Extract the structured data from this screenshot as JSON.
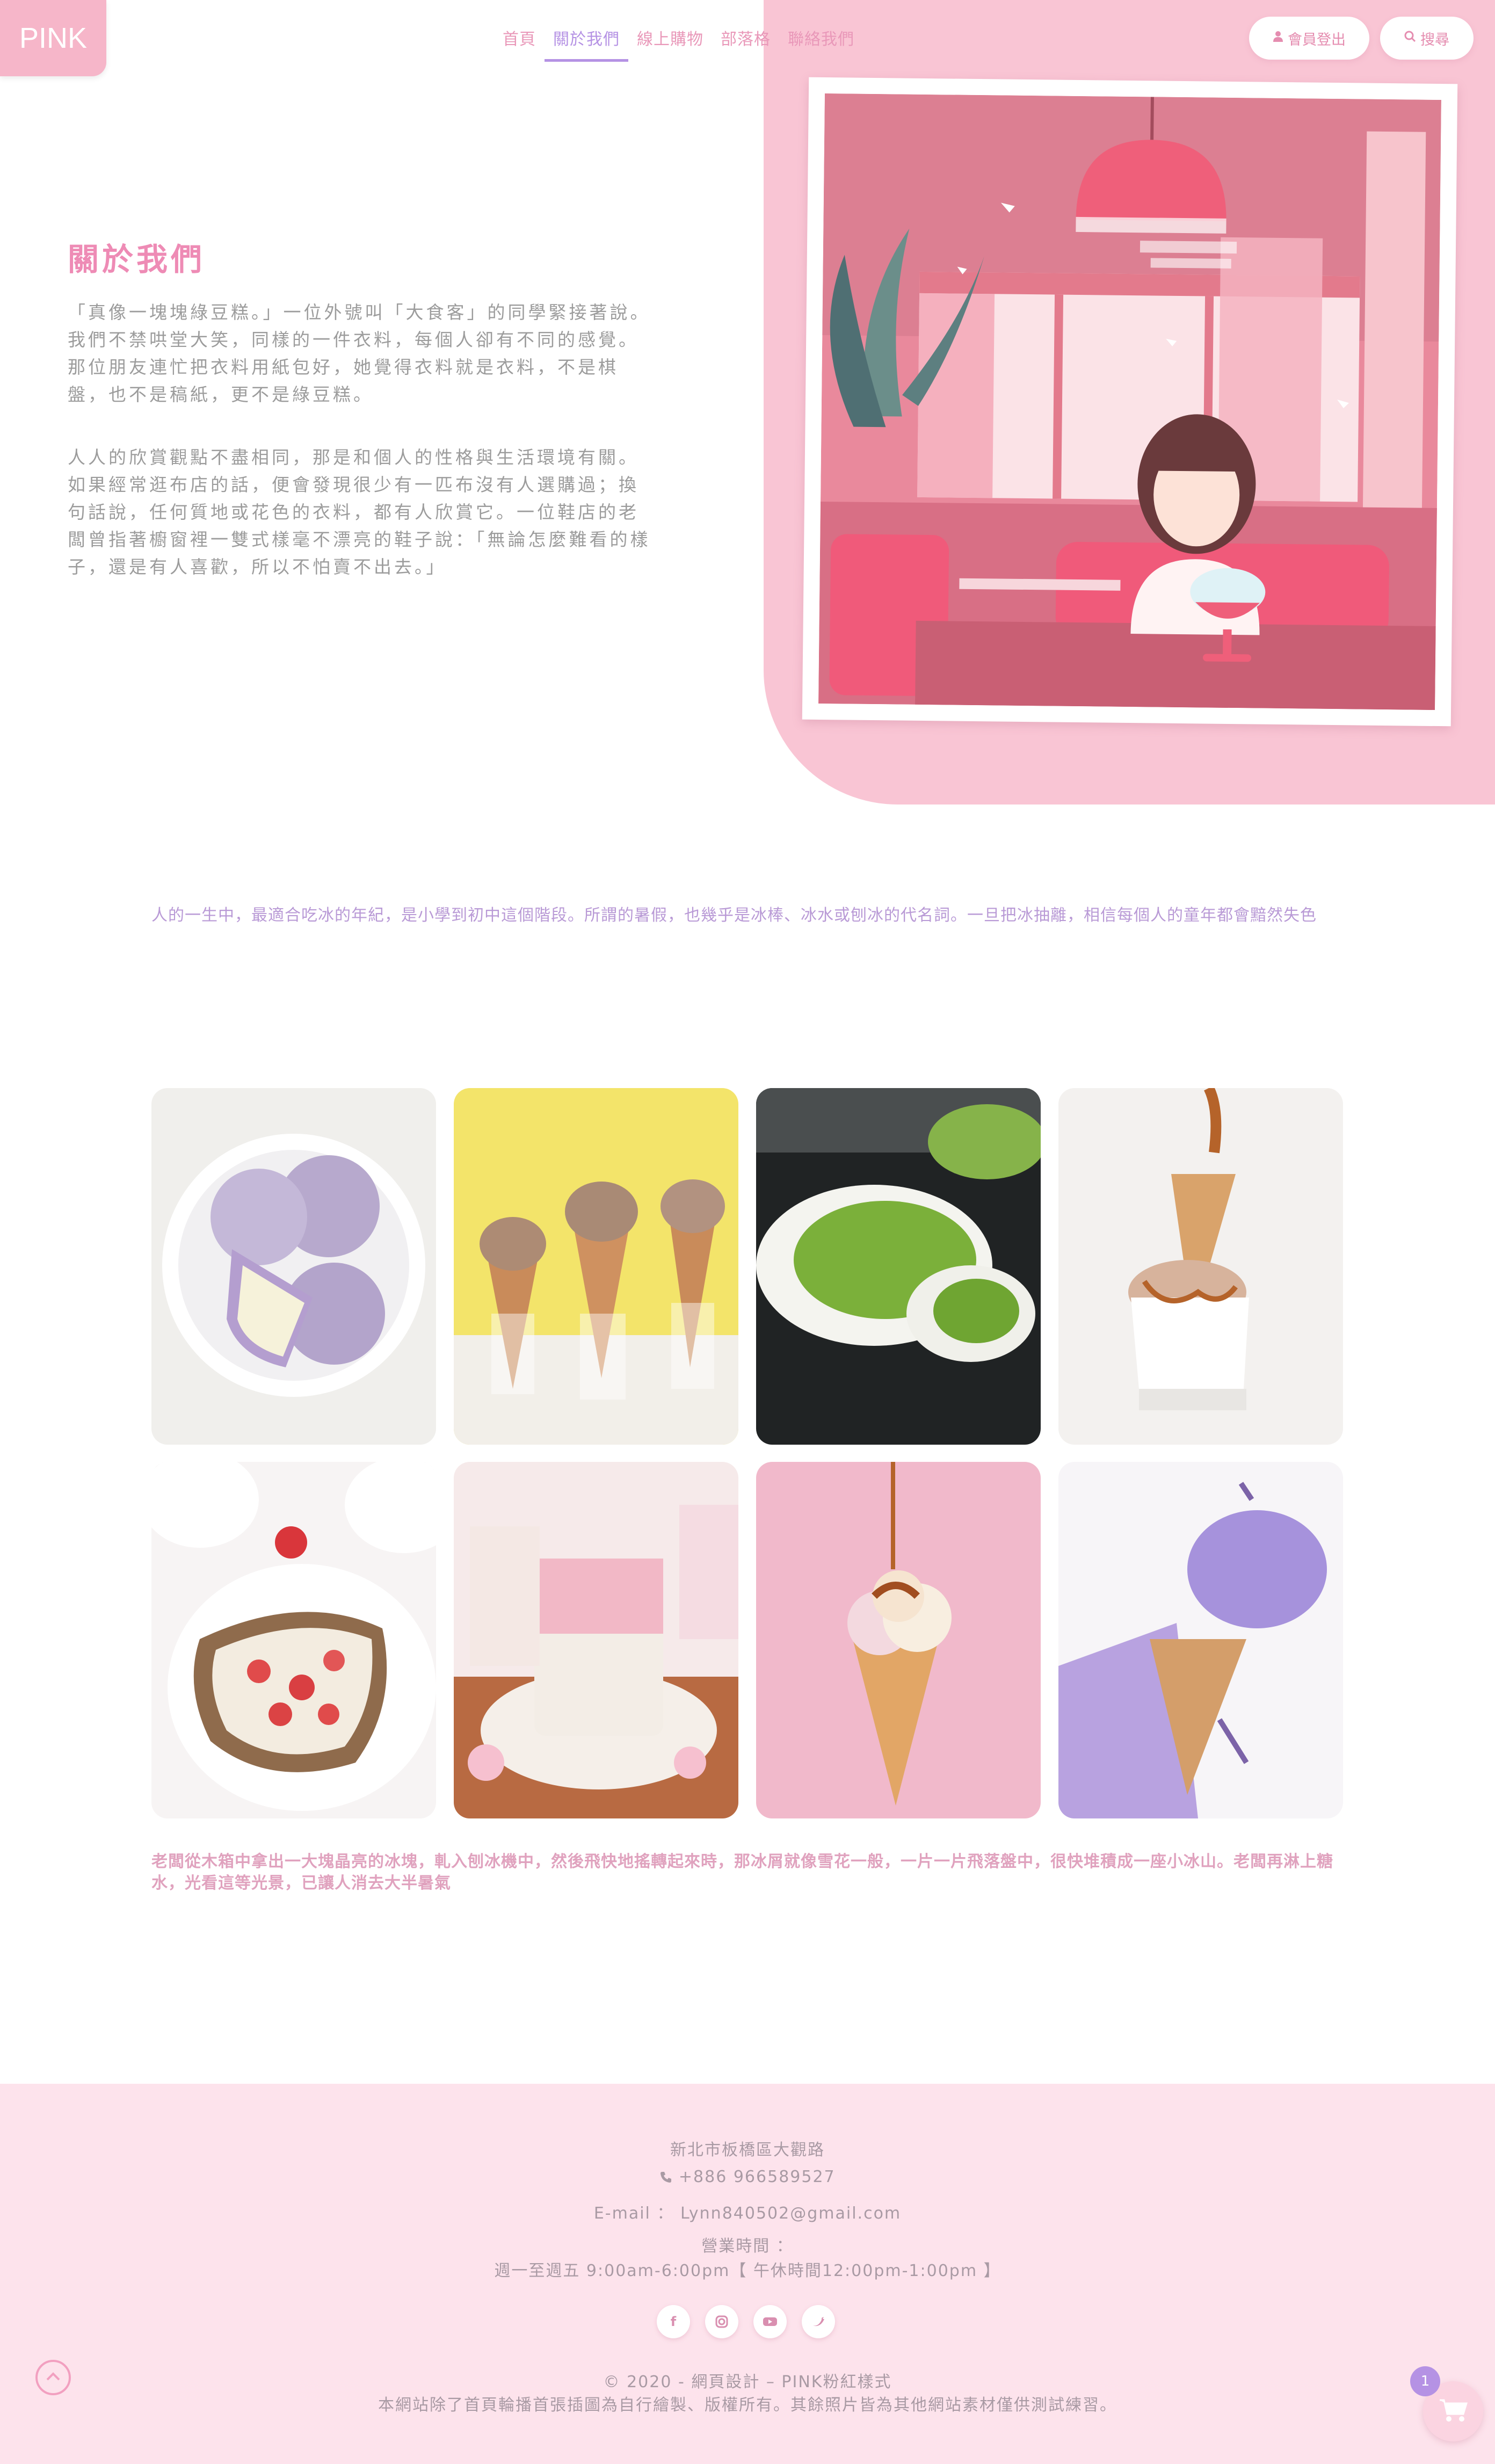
{
  "logo": {
    "text": "PINK"
  },
  "nav": {
    "items": [
      "首頁",
      "關於我們",
      "線上購物",
      "部落格",
      "聯絡我們"
    ],
    "active": "關於我們"
  },
  "header_buttons": {
    "member_logout": {
      "icon": "user-icon",
      "label": "會員登出"
    },
    "search": {
      "icon": "search-icon",
      "label": "搜尋"
    }
  },
  "about": {
    "title": "關於我們",
    "paragraphs": [
      "「真像一塊塊綠豆糕。」一位外號叫「大食客」的同學緊接著說。\n我們不禁哄堂大笑，同樣的一件衣料，每個人卻有不同的感覺。那位朋友連忙把衣料用紙包好，她覺得衣料就是衣料，不是棋盤，也不是稿紙，更不是綠豆糕。",
      "人人的欣賞觀點不盡相同，那是和個人的性格與生活環境有關。\n如果經常逛布店的話，便會發現很少有一匹布沒有人選購過；換句話說，任何質地或花色的衣料，都有人欣賞它。一位鞋店的老闆曾指著櫥窗裡一雙式樣毫不漂亮的鞋子說：「無論怎麼難看的樣子，還是有人喜歡，所以不怕賣不出去。」"
    ]
  },
  "intro_text": "人的一生中，最適合吃冰的年紀，是小學到初中這個階段。所謂的暑假，也幾乎是冰棒、冰水或刨冰的代名詞。一旦把冰抽離，相信每個人的童年都會黯然失色",
  "gallery": [
    {
      "name": "taro-mochi-photo"
    },
    {
      "name": "ice-cream-cones-photo"
    },
    {
      "name": "matcha-mochi-photo"
    },
    {
      "name": "caramel-ice-cream-photo"
    },
    {
      "name": "strawberry-toast-photo"
    },
    {
      "name": "sakura-drink-photo"
    },
    {
      "name": "pink-cone-photo"
    },
    {
      "name": "lavender-ice-cream-photo"
    }
  ],
  "closing_text": "老闆從木箱中拿出一大塊晶亮的冰塊，軋入刨冰機中，然後飛快地搖轉起來時，那冰屑就像雪花一般，一片一片飛落盤中，很快堆積成一座小冰山。老闆再淋上糖水，光看這等光景，已讓人消去大半暑氣",
  "footer": {
    "address": "新北市板橋區大觀路",
    "phone": "+886 966589527",
    "email": "E-mail ： Lynn840502@gmail.com",
    "hours_label": "營業時間 ：",
    "hours": "週一至週五 9:00am-6:00pm【 午休時間12:00pm-1:00pm 】",
    "socials": [
      "facebook-icon",
      "instagram-icon",
      "youtube-icon",
      "twitter-icon"
    ],
    "copyright": "© 2020 - 網頁設計 – PINK粉紅樣式",
    "disclaimer": "本網站除了首頁輪播首張插圖為自行繪製、版權所有。其餘照片皆為其他網站素材僅供測試練習。"
  },
  "cart": {
    "count": "1"
  },
  "colors": {
    "accent_pink": "#ee8bb5",
    "accent_purple": "#b592e4",
    "hero_bg": "#f9c5d4",
    "footer_bg": "#fde3ec"
  }
}
